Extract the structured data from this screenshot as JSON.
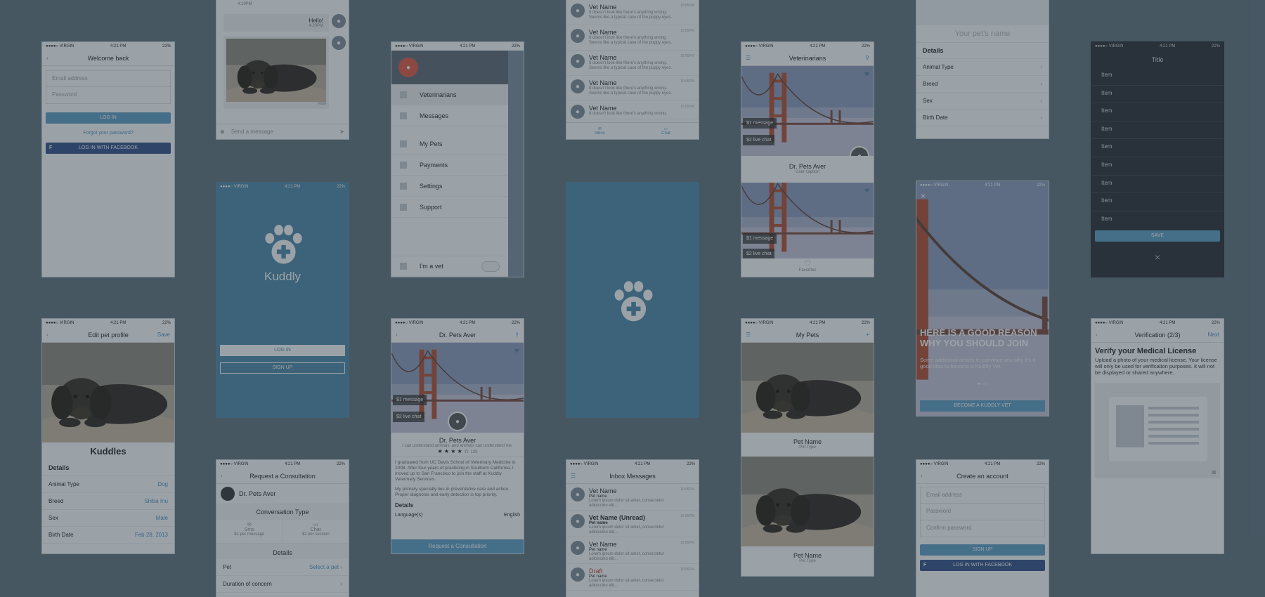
{
  "status": {
    "carrier": "●●●●○ VIRGIN",
    "time": "4:21 PM",
    "battery": "22%"
  },
  "welcome": {
    "title": "Welcome back",
    "email_placeholder": "Email address",
    "password_placeholder": "Password",
    "login": "LOG IN",
    "forgot": "Forgot your password?",
    "facebook": "LOG IN WITH FACEBOOK"
  },
  "chat": {
    "time1": "4:19PM",
    "msg": "Hello!",
    "time2": "4:20PM",
    "now": "Now",
    "placeholder": "Send a message"
  },
  "splash": {
    "app_name": "Kuddly",
    "login": "LOG IN",
    "signup": "SIGN UP"
  },
  "edit_pet": {
    "title": "Edit pet profile",
    "save": "Save",
    "name": "Kuddles",
    "details": "Details",
    "rows": [
      {
        "label": "Animal Type",
        "value": "Dog"
      },
      {
        "label": "Breed",
        "value": "Shiba Inu"
      },
      {
        "label": "Sex",
        "value": "Male"
      },
      {
        "label": "Birth Date",
        "value": "Feb 28, 2013"
      }
    ]
  },
  "consult": {
    "title": "Request a Consultation",
    "vet": "Dr. Pets Aver",
    "conversation_type": "Conversation Type",
    "opt1": "Sms",
    "opt1_sub": "$1 per message",
    "opt2": "Chat",
    "opt2_sub": "$2 per session",
    "details": "Details",
    "pet_label": "Pet",
    "pet_value": "Select a pet",
    "duration": "Duration of concern"
  },
  "drawer": {
    "items": [
      "Veterinarians",
      "Messages",
      "My Pets",
      "Payments",
      "Settings",
      "Support"
    ],
    "vet_toggle": "I'm a vet"
  },
  "vet_profile": {
    "title": "Dr. Pets Aver",
    "badge1": "$1 message",
    "badge2": "$2 live chat",
    "name": "Dr. Pets Aver",
    "tagline": "I can understand animals, and animals can understand me.",
    "stars": "★ ★ ★ ★ ☆",
    "reviews": "129",
    "bio1": "I graduated from UC Davis School of Veterinary Medicine in 2008. After four years of practicing in Southern California, I moved up to San Francisco to join the staff at Kuddly Veterinary Services.",
    "bio2": "My primary specialty lies in preventative care and action. Proper diagnosis and early detection is top priority.",
    "details": "Details",
    "lang_label": "Language(s)",
    "lang_value": "English",
    "cta": "Request a Consultation"
  },
  "vet_msgs": {
    "name": "Vet Name",
    "time": "10:05PM",
    "preview": "It doesn't look like there's anything wrong. Seems like a typical case of the puppy eyes.",
    "tab1": "Inbox",
    "tab2": "Chat"
  },
  "inbox": {
    "title": "Inbox Messages",
    "rows": [
      {
        "name": "Vet Name",
        "pet": "Pet name",
        "time": "10:05PM"
      },
      {
        "name": "Vet Name (Unread)",
        "pet": "Pet name",
        "time": "10:05PM"
      },
      {
        "name": "Vet Name",
        "pet": "Pet name",
        "time": "10:05PM"
      },
      {
        "name": "Draft",
        "pet": "Pet name",
        "time": "10:05PM"
      }
    ],
    "lorem": "Lorem ipsum dolor sit amet, consectetur adipiscing elit..."
  },
  "vets_list": {
    "title": "Veterinarians",
    "badge1": "$1 message",
    "badge2": "$2 live chat",
    "name": "Dr. Pets Aver",
    "caption": "User caption",
    "favorites": "Favorites"
  },
  "my_pets": {
    "title": "My Pets",
    "pet_name": "Pet Name",
    "pet_type": "Pet Type"
  },
  "pet_details": {
    "name_placeholder": "Your pet's name",
    "details": "Details",
    "rows": [
      "Animal Type",
      "Breed",
      "Sex",
      "Birth Date"
    ]
  },
  "join": {
    "headline": "HERE IS A GOOD REASON WHY YOU SHOULD JOIN",
    "body": "Some additional details to convince you why it's a good idea to become a Kuddly Vet.",
    "cta": "BECOME A KUDDLY VET"
  },
  "create_account": {
    "title": "Create an account",
    "email": "Email address",
    "password": "Password",
    "confirm": "Confirm password",
    "signup": "SIGN UP",
    "facebook": "LOG IN WITH FACEBOOK"
  },
  "dark_list": {
    "title": "Title",
    "item": "Item",
    "save": "SAVE"
  },
  "verify": {
    "title": "Verification (2/3)",
    "next": "Next",
    "heading": "Verify your Medical License",
    "body": "Upload a photo of your medical license. Your license will only be used for verification purposes. It will not be displayed or shared anywhere."
  },
  "colors": {
    "brand": "#5a9ec5",
    "facebook": "#2f4d88",
    "background": "#5d6f7c"
  }
}
